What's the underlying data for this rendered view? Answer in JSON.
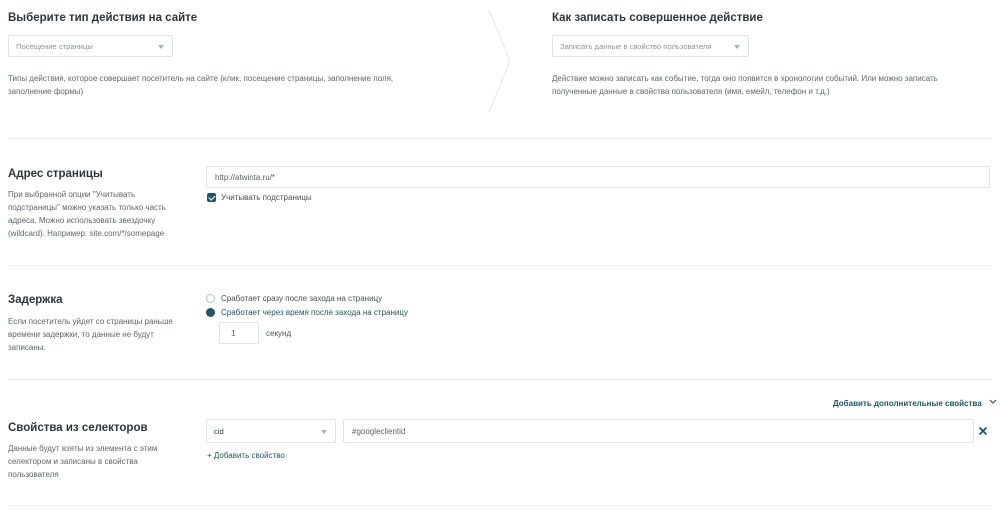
{
  "action_type": {
    "title": "Выберите тип действия на сайте",
    "select_value": "Посещение страницы",
    "description": "Типы действия, которое совершает посетитель на сайте (клик, посещение страницы, заполнение поля, заполнение формы)"
  },
  "record": {
    "title": "Как записать совершенное действие",
    "select_value": "Записать данные в свойство пользователя",
    "description": "Действие можно записать как событие, тогда оно появится в хронологии событий. Или можно записать полученные данные в свойства пользователя (имя, емейл, телефон и т.д.)"
  },
  "page_address": {
    "title": "Адрес страницы",
    "description": "При выбранной опции \"Учитывать подстраницы\" можно указать только часть адреса. Можно использовать звездочку (wildcard). Например: site.com/*/somepage",
    "url_value": "http://atwinta.ru/*",
    "subpages_label": "Учитывать подстраницы",
    "subpages_checked": true
  },
  "delay": {
    "title": "Задержка",
    "description": "Если посетитель уйдет со страницы раньше времени задержки, то данные не будут записаны.",
    "option_immediate": "Сработает сразу после захода на страницу",
    "option_delayed": "Сработает через время после захода на страницу",
    "selected": "delayed",
    "seconds_value": "1",
    "seconds_label": "секунд"
  },
  "extra": {
    "add_properties_label": "Добавить дополнительные свойства"
  },
  "selectors": {
    "title": "Свойства из селекторов",
    "description": "Данные будут взяты из элемента с этим селектором и записаны в свойства пользователя",
    "property_value": "cid",
    "selector_value": "#googleclientid",
    "add_property_label": "+ Добавить свойство",
    "remove_icon": "close-icon"
  },
  "colors": {
    "accent": "#1f5663",
    "border": "#dfe3e5",
    "text": "#2f363b",
    "muted": "#5f676b"
  }
}
